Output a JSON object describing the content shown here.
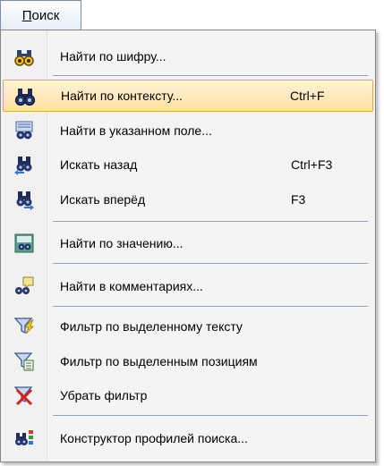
{
  "menu": {
    "title_mnemonic": "П",
    "title_rest": "оиск"
  },
  "items": [
    {
      "label": "Найти по шифру...",
      "shortcut": "",
      "icon": "binoculars-yellow-icon"
    },
    {
      "label": "Найти по контексту...",
      "shortcut": "Ctrl+F",
      "icon": "binoculars-icon"
    },
    {
      "label": "Найти в указанном поле...",
      "shortcut": "",
      "icon": "binoculars-field-icon"
    },
    {
      "label": "Искать назад",
      "shortcut": "Ctrl+F3",
      "icon": "binoculars-back-icon"
    },
    {
      "label": "Искать вперёд",
      "shortcut": "F3",
      "icon": "binoculars-forward-icon"
    },
    {
      "label": "Найти по значению...",
      "shortcut": "",
      "icon": "search-value-icon"
    },
    {
      "label": "Найти в комментариях...",
      "shortcut": "",
      "icon": "search-comments-icon"
    },
    {
      "label": "Фильтр по выделенному тексту",
      "shortcut": "",
      "icon": "filter-text-icon"
    },
    {
      "label": "Фильтр по выделенным позициям",
      "shortcut": "",
      "icon": "filter-positions-icon"
    },
    {
      "label": "Убрать фильтр",
      "shortcut": "",
      "icon": "remove-filter-icon"
    },
    {
      "label": "Конструктор профилей поиска...",
      "shortcut": "",
      "icon": "search-profile-icon"
    }
  ],
  "colors": {
    "highlight_top": "#fff4d8",
    "highlight_bottom": "#ffe0a1",
    "highlight_border": "#e2a94c",
    "separator": "#8da2c7",
    "menu_background": "#f4f4f4"
  }
}
